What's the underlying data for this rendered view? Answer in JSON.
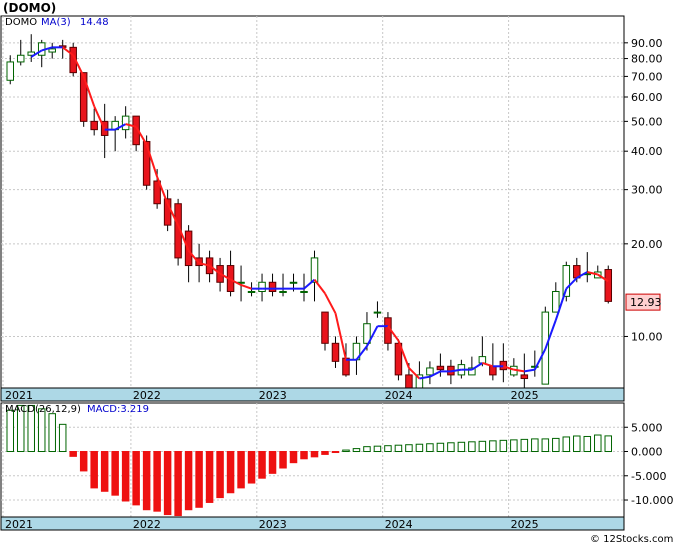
{
  "title": "(DOMO)",
  "watermark": "© 12Stocks.com",
  "colors": {
    "up": "#ffffff",
    "up_border": "#006400",
    "down": "#e8141c",
    "down_border": "#5a0000",
    "ma_up": "#1a1aff",
    "ma_down": "#ff1a1a",
    "axis_band": "#add8e6",
    "grid": "#c8c8c8",
    "macd_pos": "#ffffff",
    "macd_pos_border": "#006400",
    "macd_neg": "#ee1111",
    "last_box": "#ffd0d0"
  },
  "price_panel": {
    "legend": {
      "symbol": "DOMO",
      "ma_label": "MA(3)",
      "ma_value": "14.48"
    },
    "last_price": "12.93",
    "y_ticks": [
      "90.00",
      "80.00",
      "70.00",
      "60.00",
      "50.00",
      "40.00",
      "30.00",
      "20.00",
      "10.00"
    ],
    "years": [
      "2021",
      "2022",
      "2023",
      "2024",
      "2025"
    ]
  },
  "macd_panel": {
    "legend": {
      "label": "MACD(26,12,9)",
      "value_label": "MACD:3.219"
    },
    "y_ticks": [
      "5.000",
      "0.000",
      "-5.000",
      "-10.000"
    ],
    "years": [
      "2021",
      "2022",
      "2023",
      "2024",
      "2025"
    ]
  },
  "chart_data": [
    {
      "type": "candlestick",
      "title": "(DOMO)",
      "scale": "log",
      "ylim": [
        6.8,
        110
      ],
      "x": [
        "2021-01",
        "2021-02",
        "2021-03",
        "2021-04",
        "2021-05",
        "2021-06",
        "2021-07",
        "2021-08",
        "2021-09",
        "2021-10",
        "2021-11",
        "2021-12",
        "2022-01",
        "2022-02",
        "2022-03",
        "2022-04",
        "2022-05",
        "2022-06",
        "2022-07",
        "2022-08",
        "2022-09",
        "2022-10",
        "2022-11",
        "2022-12",
        "2023-01",
        "2023-02",
        "2023-03",
        "2023-04",
        "2023-05",
        "2023-06",
        "2023-07",
        "2023-08",
        "2023-09",
        "2023-10",
        "2023-11",
        "2023-12",
        "2024-01",
        "2024-02",
        "2024-03",
        "2024-04",
        "2024-05",
        "2024-06",
        "2024-07",
        "2024-08",
        "2024-09",
        "2024-10",
        "2024-11",
        "2024-12",
        "2025-01",
        "2025-02",
        "2025-03",
        "2025-04",
        "2025-05",
        "2025-06",
        "2025-07",
        "2025-08",
        "2025-09",
        "2025-10",
        "2025-11"
      ],
      "open": [
        68,
        78,
        82,
        82,
        84,
        88,
        87,
        72,
        50,
        50,
        47,
        47,
        52,
        43,
        32,
        28,
        27,
        22,
        18,
        18,
        17,
        17,
        15,
        14,
        14,
        15,
        14,
        15,
        14,
        15,
        12,
        9.5,
        8.5,
        8.4,
        9.5,
        12,
        11.5,
        9.5,
        7.5,
        6.8,
        7.5,
        8.0,
        8.0,
        7.5,
        7.5,
        8.2,
        8.0,
        8.3,
        7.5,
        7.5,
        8.0,
        7.0,
        12,
        13.5,
        17.0,
        16.0,
        15.5,
        16.5
      ],
      "close": [
        78,
        82,
        84,
        90,
        86,
        87,
        72,
        50,
        47,
        45,
        50,
        52,
        42,
        31,
        27,
        23,
        18,
        17,
        17,
        16,
        15,
        14,
        15,
        14,
        15,
        14,
        14,
        15,
        14,
        18,
        9.5,
        8.3,
        7.5,
        9.5,
        11,
        12,
        9.5,
        7.5,
        6.8,
        7.5,
        7.9,
        7.8,
        7.5,
        8.1,
        7.9,
        8.6,
        7.5,
        7.8,
        8.0,
        7.3,
        8.0,
        12,
        14,
        17.0,
        15.5,
        16.0,
        16.2,
        13.0
      ],
      "high": [
        82,
        92,
        96,
        92,
        90,
        92,
        90,
        72,
        55,
        57,
        52,
        56,
        52,
        45,
        35,
        30,
        28,
        23,
        20,
        19,
        18,
        19,
        17,
        15,
        16,
        16,
        16,
        16,
        16,
        19,
        12,
        10,
        9.5,
        10,
        12,
        13,
        12,
        9.8,
        8.2,
        8.3,
        8.3,
        8.8,
        8.4,
        8.4,
        8.6,
        10,
        9.5,
        9.5,
        8.5,
        8.8,
        9.0,
        12.5,
        15,
        17.5,
        18,
        18.8,
        17,
        17
      ],
      "low": [
        66,
        76,
        78,
        75,
        80,
        80,
        70,
        48,
        45,
        38,
        40,
        44,
        40,
        30,
        26,
        22,
        17,
        15,
        15,
        15,
        14,
        13.5,
        13,
        13.5,
        13,
        13.5,
        13.5,
        14,
        13,
        13,
        9.0,
        7.9,
        7.4,
        7.5,
        9.0,
        11.5,
        9.0,
        7.2,
        6.5,
        6.8,
        7.0,
        7.4,
        7.0,
        7.3,
        7.5,
        8.0,
        7.2,
        7.1,
        7.4,
        6.5,
        7.4,
        7.0,
        12,
        13,
        15,
        15,
        15.5,
        12.8
      ],
      "ma": {
        "name": "MA(3)",
        "values": [
          null,
          null,
          81,
          85,
          87,
          87,
          82,
          70,
          56,
          47,
          47,
          49,
          48,
          42,
          33,
          27,
          23,
          19,
          17.3,
          17,
          16,
          15.3,
          14.7,
          14.3,
          14.3,
          14.3,
          14.3,
          14.3,
          14.3,
          15.3,
          13.8,
          11.9,
          8.4,
          8.4,
          9.3,
          10.8,
          10.8,
          9.7,
          7.9,
          7.3,
          7.4,
          7.7,
          7.7,
          7.8,
          7.8,
          8.2,
          8.0,
          8.0,
          7.8,
          7.7,
          7.8,
          9.1,
          11.3,
          14.3,
          15.5,
          16.2,
          15.9,
          15.1
        ],
        "last": 14.48
      },
      "last_price": 12.93,
      "years": [
        "2021",
        "2022",
        "2023",
        "2024",
        "2025"
      ]
    },
    {
      "type": "bar",
      "title": "MACD(26,12,9)",
      "series": [
        {
          "name": "MACD:3.219",
          "values": [
            8.5,
            9.5,
            9.5,
            8.8,
            7.8,
            5.6,
            -1.0,
            -4.0,
            -7.5,
            -8.2,
            -9.0,
            -10.2,
            -11.0,
            -12.0,
            -12.3,
            -13.0,
            -13.2,
            -12.0,
            -11.5,
            -10.5,
            -9.5,
            -8.5,
            -7.5,
            -6.5,
            -5.5,
            -4.5,
            -3.4,
            -2.3,
            -1.5,
            -1.1,
            -0.6,
            -0.2,
            0.3,
            0.6,
            1.0,
            1.1,
            1.2,
            1.3,
            1.4,
            1.5,
            1.6,
            1.7,
            1.8,
            1.9,
            2.0,
            2.1,
            2.2,
            2.3,
            2.4,
            2.5,
            2.6,
            2.6,
            2.7,
            3.0,
            3.2,
            3.1,
            3.4,
            3.219
          ]
        }
      ],
      "ylim": [
        -13.5,
        10
      ]
    }
  ]
}
